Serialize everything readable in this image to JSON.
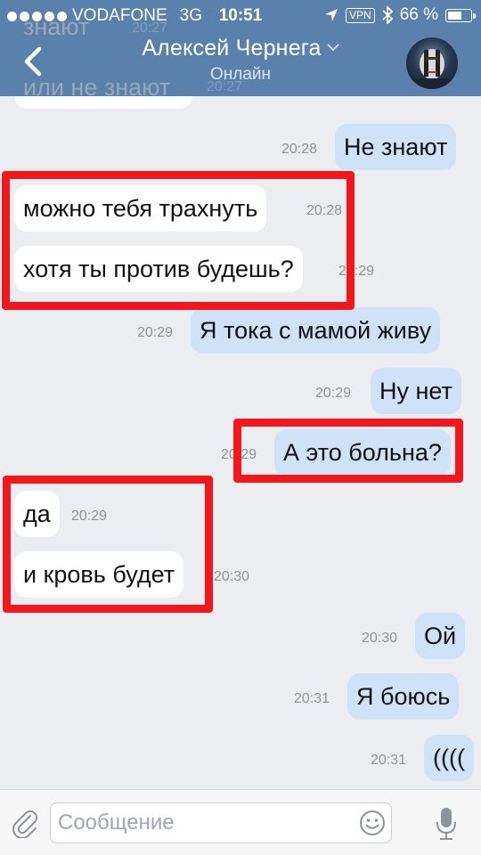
{
  "status_bar": {
    "carrier": "VODAFONE",
    "network": "3G",
    "time": "10:51",
    "vpn": "VPN",
    "battery": "66 %",
    "battery_level": 0.66
  },
  "header": {
    "title": "Алексей Чернега",
    "subtitle": "Онлайн",
    "back_icon": "chevron-left-icon",
    "color": "#5a80ac"
  },
  "chat": {
    "ghost_messages": [
      {
        "text": "знают",
        "time": "20:27"
      },
      {
        "text": "или не знают",
        "time": "20:27"
      }
    ],
    "messages": [
      {
        "dir": "out",
        "text": "Не знают",
        "time": "20:28"
      },
      {
        "dir": "in",
        "text": "можно тебя трахнуть",
        "time": "20:28"
      },
      {
        "dir": "in",
        "text": "хотя ты против будешь?",
        "time": "20:29"
      },
      {
        "dir": "out",
        "text": "Я тока с мамой живу",
        "time": "20:29"
      },
      {
        "dir": "out",
        "text": "Ну нет",
        "time": "20:29"
      },
      {
        "dir": "out",
        "text": "А это больна?",
        "time": "20:29"
      },
      {
        "dir": "in",
        "text": "да",
        "time": "20:29"
      },
      {
        "dir": "in",
        "text": "и кровь будет",
        "time": "20:30"
      },
      {
        "dir": "out",
        "text": "Ой",
        "time": "20:30"
      },
      {
        "dir": "out",
        "text": "Я боюсь",
        "time": "20:31"
      },
      {
        "dir": "out",
        "text": "((((",
        "time": "20:31"
      }
    ]
  },
  "composer": {
    "placeholder": "Сообщение",
    "attach_icon": "paperclip-icon",
    "emoji_icon": "smiley-icon",
    "mic_icon": "microphone-icon"
  },
  "colors": {
    "incoming_bubble": "#ffffff",
    "outgoing_bubble": "#cfe2f7",
    "background": "#ecedf1",
    "highlight_box": "#f2161d"
  }
}
